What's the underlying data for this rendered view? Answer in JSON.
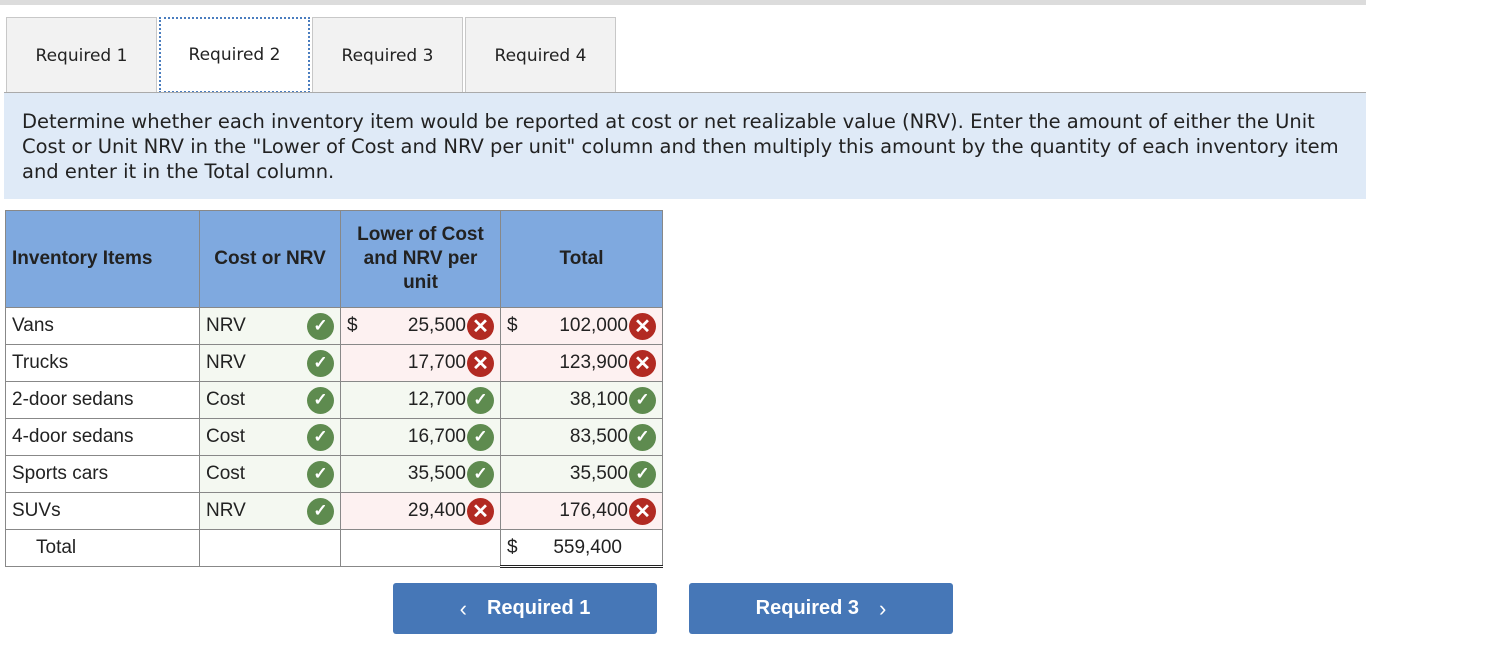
{
  "tabs": [
    {
      "label": "Required 1",
      "active": false
    },
    {
      "label": "Required 2",
      "active": true
    },
    {
      "label": "Required 3",
      "active": false
    },
    {
      "label": "Required 4",
      "active": false
    }
  ],
  "instructions": "Determine whether each inventory item would be reported at cost or net realizable value (NRV). Enter the amount of either the Unit Cost or Unit NRV in the \"Lower of Cost and NRV per unit\" column and then multiply this amount by the quantity of each inventory item and enter it in the Total column.",
  "table": {
    "headers": [
      "Inventory Items",
      "Cost or NRV",
      "Lower of Cost and NRV per unit",
      "Total"
    ],
    "rows": [
      {
        "item": "Vans",
        "basis": "NRV",
        "basis_ok": true,
        "unit": "25,500",
        "unit_ok": false,
        "total": "102,000",
        "total_ok": false,
        "dollar": true
      },
      {
        "item": "Trucks",
        "basis": "NRV",
        "basis_ok": true,
        "unit": "17,700",
        "unit_ok": false,
        "total": "123,900",
        "total_ok": false,
        "dollar": false
      },
      {
        "item": "2-door sedans",
        "basis": "Cost",
        "basis_ok": true,
        "unit": "12,700",
        "unit_ok": true,
        "total": "38,100",
        "total_ok": true,
        "dollar": false
      },
      {
        "item": "4-door sedans",
        "basis": "Cost",
        "basis_ok": true,
        "unit": "16,700",
        "unit_ok": true,
        "total": "83,500",
        "total_ok": true,
        "dollar": false
      },
      {
        "item": "Sports cars",
        "basis": "Cost",
        "basis_ok": true,
        "unit": "35,500",
        "unit_ok": true,
        "total": "35,500",
        "total_ok": true,
        "dollar": false
      },
      {
        "item": "SUVs",
        "basis": "NRV",
        "basis_ok": true,
        "unit": "29,400",
        "unit_ok": false,
        "total": "176,400",
        "total_ok": false,
        "dollar": false
      }
    ],
    "total_label": "Total",
    "grand_total": "559,400",
    "currency": "$"
  },
  "nav": {
    "prev_label": "Required 1",
    "next_label": "Required 3",
    "prev_icon": "‹",
    "next_icon": "›"
  },
  "icons": {
    "correct": "✓",
    "incorrect": "✕"
  }
}
